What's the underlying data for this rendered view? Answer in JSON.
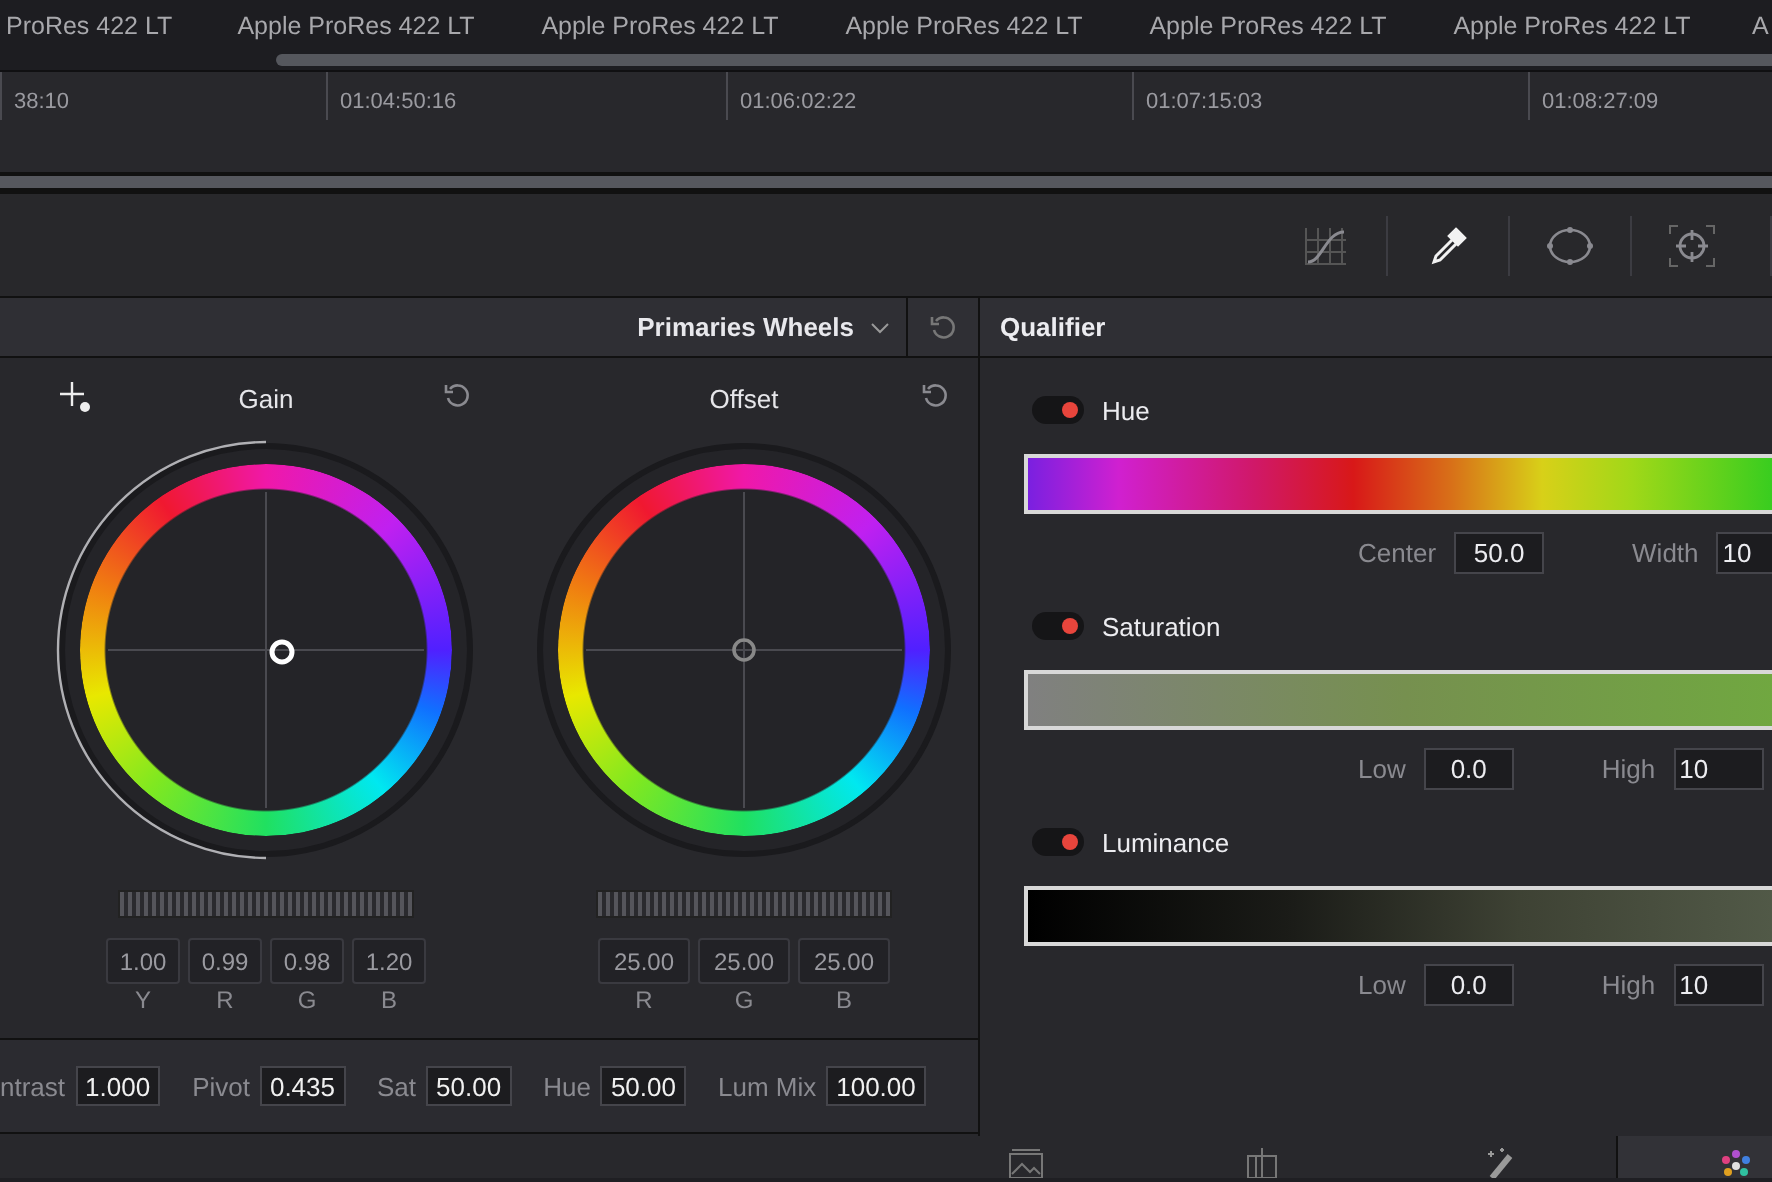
{
  "clips": [
    "ProRes 422 LT",
    "Apple ProRes 422 LT",
    "Apple ProRes 422 LT",
    "Apple ProRes 422 LT",
    "Apple ProRes 422 LT",
    "Apple ProRes 422 LT",
    "A"
  ],
  "timecodes": [
    "38:10",
    "01:04:50:16",
    "01:06:02:22",
    "01:07:15:03",
    "01:08:27:09"
  ],
  "toolbar": [
    {
      "kind": "curves",
      "selected": false
    },
    {
      "kind": "eyedropper",
      "selected": true
    },
    {
      "kind": "window",
      "selected": false
    },
    {
      "kind": "tracker",
      "selected": false
    }
  ],
  "wheels_panel": {
    "mode": "Primaries Wheels",
    "wheels": [
      {
        "name": "Gain",
        "picker": true,
        "adjusted": true,
        "level": 0.5,
        "values": [
          {
            "value": "1.00",
            "label": "Y"
          },
          {
            "value": "0.99",
            "label": "R"
          },
          {
            "value": "0.98",
            "label": "G"
          },
          {
            "value": "1.20",
            "label": "B"
          }
        ]
      },
      {
        "name": "Offset",
        "picker": false,
        "adjusted": false,
        "values": [
          {
            "value": "25.00",
            "label": "R"
          },
          {
            "value": "25.00",
            "label": "G"
          },
          {
            "value": "25.00",
            "label": "B"
          }
        ]
      }
    ],
    "params": [
      {
        "label": "ntrast",
        "value": "1.000"
      },
      {
        "label": "Pivot",
        "value": "0.435"
      },
      {
        "label": "Sat",
        "value": "50.00"
      },
      {
        "label": "Hue",
        "value": "50.00"
      },
      {
        "label": "Lum Mix",
        "value": "100.00"
      }
    ]
  },
  "qualifier": {
    "title": "Qualifier",
    "channels": [
      {
        "kind": "hue",
        "name": "Hue",
        "on": true,
        "fields": [
          {
            "label": "Center",
            "value": "50.0"
          },
          {
            "label": "Width",
            "value": "10"
          }
        ]
      },
      {
        "kind": "saturation",
        "name": "Saturation",
        "on": true,
        "fields": [
          {
            "label": "Low",
            "value": "0.0"
          },
          {
            "label": "High",
            "value": "10"
          }
        ]
      },
      {
        "kind": "luminance",
        "name": "Luminance",
        "on": true,
        "fields": [
          {
            "label": "Low",
            "value": "0.0"
          },
          {
            "label": "High",
            "value": "10"
          }
        ]
      }
    ]
  },
  "page_tabs": [
    {
      "kind": "gallery",
      "selected": false
    },
    {
      "kind": "clips",
      "selected": false
    },
    {
      "kind": "effects",
      "selected": false
    },
    {
      "kind": "color",
      "selected": true
    }
  ]
}
